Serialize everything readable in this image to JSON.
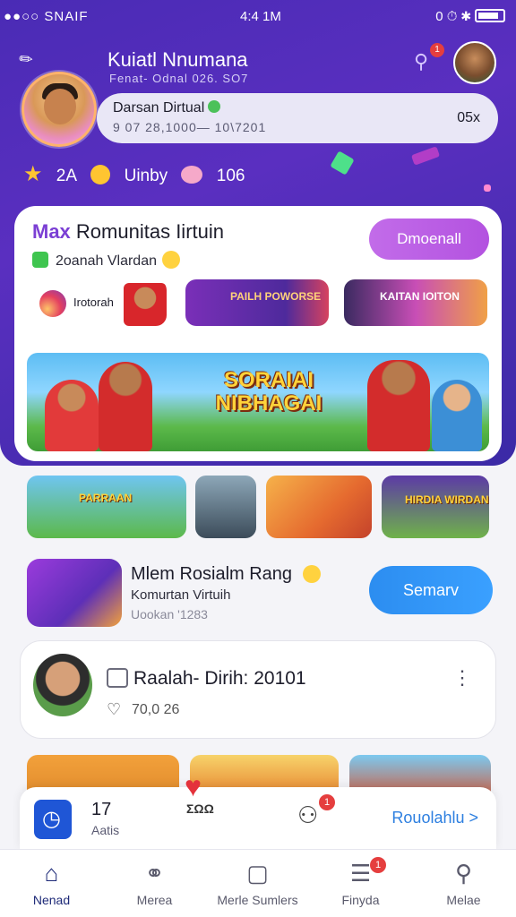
{
  "status_bar": {
    "carrier": "●●○○ SNAIF",
    "time": "4:4 1M",
    "right_icons": "0 ⏱ ✱"
  },
  "profile": {
    "name": "Kuiatl Nnumana",
    "subtitle": "Fenat-  Odnal  026.  SO7",
    "status_title": "Darsan  Dirtual",
    "status_value": "9 07  28,1000—  10\\7201",
    "status_right": "05x",
    "notification_count": "1"
  },
  "stats": {
    "stars": "2A",
    "coins_label": "Uinby",
    "pigs": "106"
  },
  "community_card": {
    "title_accent": "Max",
    "title": "Romunitas Iirtuin",
    "subtitle": "2oanah  Vlardan",
    "button_label": "Dmoenall",
    "mini_items": [
      {
        "label": "Irotorah"
      },
      {
        "label": "PAILH POWORSE"
      },
      {
        "label": "KAITAN IOITON"
      }
    ],
    "banner_title": "SORAIAI NIBHAGAI"
  },
  "thumbnails": [
    {
      "label": "PARRAAN"
    },
    {
      "label": ""
    },
    {
      "label": ""
    },
    {
      "label": "HIRDIA WIRDAN"
    }
  ],
  "featured_item": {
    "title": "Mlem Rosialm Rang",
    "subtitle": "Komurtan Virtuih",
    "meta": "Uookan '1283",
    "button_label": "Semarv"
  },
  "list_card": {
    "title": "Raalah-  Dirih:  20101",
    "count": "70,0  26"
  },
  "floating_bar": {
    "count": "17",
    "count_label": "Aatis",
    "mid_label": "ΣΩΩ",
    "badge": "1",
    "link": "Rouolahlu >"
  },
  "tabs": [
    {
      "label": "Nenad",
      "icon": "home-icon",
      "active": true
    },
    {
      "label": "Merea",
      "icon": "people-icon",
      "active": false
    },
    {
      "label": "Merle Sumlers",
      "icon": "chat-icon",
      "active": false
    },
    {
      "label": "Finyda",
      "icon": "news-icon",
      "active": false,
      "badge": "1"
    },
    {
      "label": "Melae",
      "icon": "search-icon",
      "active": false
    }
  ],
  "colors": {
    "hero": "#4a2bb5",
    "purple_button": "#b352e0",
    "blue_button": "#2c8df0",
    "active_tab": "#1e2a78"
  }
}
